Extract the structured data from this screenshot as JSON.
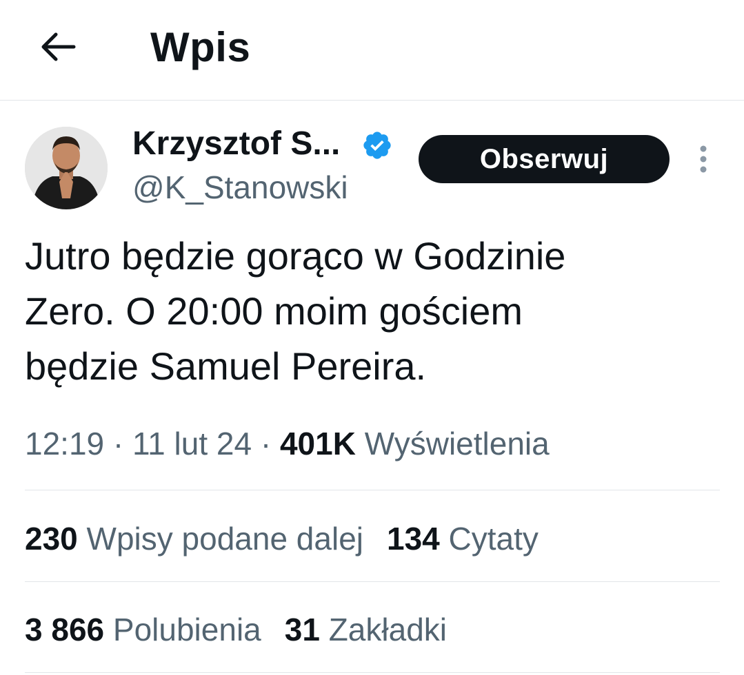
{
  "header": {
    "title": "Wpis"
  },
  "author": {
    "name": "Krzysztof S...",
    "handle": "@K_Stanowski",
    "verified": true
  },
  "follow_label": "Obserwuj",
  "tweet": {
    "text": "Jutro będzie gorąco w Godzinie\nZero. O 20:00 moim gościem\nbędzie Samuel Pereira."
  },
  "meta": {
    "time": "12:19",
    "separator": " · ",
    "date": "11 lut 24",
    "views_count": "401K",
    "views_label": "Wyświetlenia"
  },
  "stats_row1": {
    "reposts_count": "230",
    "reposts_label": "Wpisy podane dalej",
    "quotes_count": "134",
    "quotes_label": "Cytaty"
  },
  "stats_row2": {
    "likes_count": "3 866",
    "likes_label": "Polubienia",
    "bookmarks_count": "31",
    "bookmarks_label": "Zakładki"
  },
  "colors": {
    "text_primary": "#0f1419",
    "text_secondary": "#536471",
    "verified_blue": "#1d9bf0",
    "divider": "#e1e5e8"
  },
  "icons": {
    "back": "arrow-left-icon",
    "verified": "verified-badge-icon",
    "more": "more-vertical-icon"
  }
}
